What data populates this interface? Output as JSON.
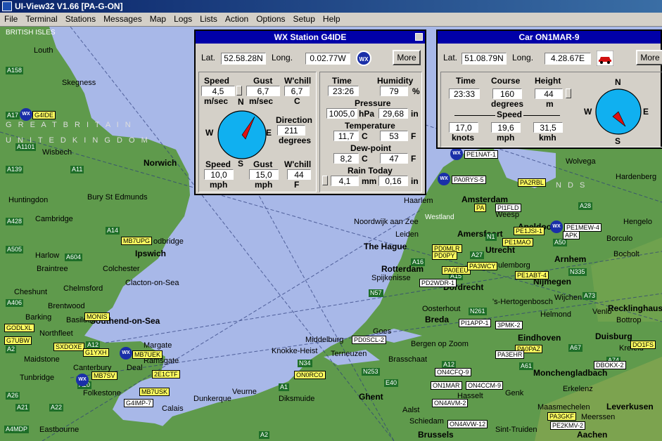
{
  "window": {
    "title": "UI-View32 V1.66 [PA-G-ON]"
  },
  "menu": [
    "File",
    "Terminal",
    "Stations",
    "Messages",
    "Map",
    "Logs",
    "Lists",
    "Action",
    "Options",
    "Setup",
    "Help"
  ],
  "map": {
    "regions": {
      "british_isles": "BRITISH ISLES",
      "great_britain": "G R E A T   B R I T A I N",
      "united_kingdom": "U N I T E D   K I N G D O M",
      "nl_frag": "N D S"
    },
    "places": {
      "louth": "Louth",
      "skegness": "Skegness",
      "wisbech": "Wisbech",
      "norwich": "Norwich",
      "huntingdon": "Huntingdon",
      "bury": "Bury St Edmunds",
      "cambridge": "Cambridge",
      "ipswich": "Ipswich",
      "woodbridge": "odbridge",
      "harlow": "Harlow",
      "braintree": "Braintree",
      "colchester": "Colchester",
      "chelmsford": "Chelmsford",
      "clacton": "Clacton-on-Sea",
      "cheshunt": "Cheshunt",
      "brentwood": "Brentwood",
      "basildon": "Basildon",
      "barking": "Barking",
      "southend": "Southend-on-Sea",
      "northfleet": "Northfleet",
      "maidstone": "Maidstone",
      "margate": "Margate",
      "ramsgate": "Ramsgate",
      "canterbury": "Canterbury",
      "deal": "Deal",
      "tunbridge": "Tunbridge",
      "folkestone": "Folkestone",
      "calais": "Calais",
      "dunkerque": "Dunkerque",
      "veurne": "Veurne",
      "diksmuide": "Diksmuide",
      "eastbourne": "Eastbourne",
      "knokke": "Knokke-Heist",
      "middelburg": "Middelburg",
      "terneuzen": "Terneuzen",
      "goes": "Goes",
      "brasschaat": "Brasschaat",
      "gent": "Ghent",
      "brussels": "Brussels",
      "aalst": "Aalst",
      "haarlem": "Haarlem",
      "amsterdam": "Amsterdam",
      "noordwijk": "Noordwijk aan Zee",
      "leiden": "Leiden",
      "hague": "The Hague",
      "rotterdam": "Rotterdam",
      "spijkenisse": "Spijkenisse",
      "dordrecht": "Dordrecht",
      "amersfoort": "Amersfoort",
      "apeldoorn": "Apeldoorn",
      "arnhem": "Arnhem",
      "utrecht": "Utrecht",
      "culemborg": "Culemborg",
      "nijmegen": "Nijmegen",
      "hertogenbosch": "'s-Hertogenbosch",
      "oosterhout": "Oosterhout",
      "breda": "Breda",
      "bergen_op_zoom": "Bergen op Zoom",
      "eindhoven": "Eindhoven",
      "helmond": "Helmond",
      "venlo": "Venlo",
      "moenchengladbach": "Monchengladbach",
      "erkelenz": "Erkelenz",
      "maasmechelen": "Maasmechelen",
      "sint_truiden": "Sint-Truiden",
      "aachen": "Aachen",
      "leverkusen": "Leverkusen",
      "duisburg": "Duisburg",
      "krefeld": "Krefeld",
      "bottrop": "Bottrop",
      "recklinghausen": "Recklinghausen",
      "hardenberg": "Hardenberg",
      "hengelo": "Hengelo",
      "wolvega": "Wolvega",
      "genk": "Genk",
      "hasselt": "Hasselt",
      "bocholt": "Bocholt",
      "wijchen": "Wijchen",
      "borculo": "Borculo",
      "weesp": "Weesp",
      "westland": "Westland",
      "meerssen": "Meerssen",
      "schiedam": "Schiedam"
    },
    "roads": [
      "A158",
      "A17",
      "A1101",
      "A139",
      "A11",
      "A14",
      "A428",
      "A505",
      "A604",
      "A406",
      "A2",
      "A12",
      "A26",
      "A21",
      "A22",
      "A20",
      "A4MDP",
      "N34",
      "N253",
      "N57",
      "N261",
      "A1",
      "E40",
      "A15",
      "A16",
      "A27",
      "A2",
      "A12",
      "N1",
      "A50",
      "A28",
      "N335",
      "A73",
      "A67",
      "A61",
      "A74"
    ],
    "stations": [
      "G4IDE",
      "MB7UPG",
      "MONIS",
      "GODLXL",
      "G7UBW",
      "SXDOXE",
      "G1YXH",
      "MB7UEK",
      "2E1CTF",
      "MB7SV",
      "G4IMP-7",
      "MB7USK",
      "PE1NAT-1",
      "PA0RYS-5",
      "PA2RBL",
      "PA",
      "PI1FLD",
      "PE1JSI-1",
      "PE1MEW-4",
      "APK",
      "PE1MAO",
      "PD0MLR",
      "PD0PY",
      "PA0EEU",
      "PA3WCY",
      "PE1ABT-4",
      "PD2WDR-1",
      "PI1APP-1",
      "3PMK-2",
      "PA0PAZ",
      "PA3EHR",
      "PD0SCL-2",
      "ON0RCO",
      "ON4CFQ-9",
      "ON1MAR",
      "ON4CCM-9",
      "ON4AVM-2",
      "ON4AVW-12",
      "PA3GKF",
      "PE2KMV-2",
      "DBOKX-2",
      "DO1FS"
    ]
  },
  "wx_panel": {
    "title": "WX Station  G4IDE",
    "lat_label": "Lat.",
    "lat": "52.58.28N",
    "long_label": "Long.",
    "long": "0.02.77W",
    "badge": "WX",
    "more": "More",
    "speed_label": "Speed",
    "gust_label": "Gust",
    "wchill_label": "W'chill",
    "speed_ms": "4,5",
    "gust_ms": "6,7",
    "wchill_c": "6,7",
    "unit_ms": "m/sec",
    "unit_c": "C",
    "direction_label": "Direction",
    "direction": "211",
    "degrees_label": "degrees",
    "compass_n": "N",
    "compass_e": "E",
    "compass_s": "S",
    "compass_w": "W",
    "speed_mph": "10,0",
    "gust_mph": "15,0",
    "wchill_f": "44",
    "unit_mph": "mph",
    "unit_f": "F",
    "time_label": "Time",
    "time": "23:26",
    "humidity_label": "Humidity",
    "humidity": "79",
    "unit_pct": "%",
    "pressure_label": "Pressure",
    "pressure_hpa": "1005,0",
    "unit_hpa": "hPa",
    "pressure_in": "29,68",
    "unit_in": "in",
    "temp_label": "Temperature",
    "temp_c": "11,7",
    "temp_f": "53",
    "dew_label": "Dew-point",
    "dew_c": "8,2",
    "dew_f": "47",
    "rain_label": "Rain Today",
    "rain_mm": "4,1",
    "unit_mm": "mm",
    "rain_in": "0,16"
  },
  "car_panel": {
    "title": "Car  ON1MAR-9",
    "lat_label": "Lat.",
    "lat": "51.08.79N",
    "long_label": "Long.",
    "long": "4.28.67E",
    "more": "More",
    "time_label": "Time",
    "time": "23:33",
    "course_label": "Course",
    "course": "160",
    "degrees_label": "degrees",
    "height_label": "Height",
    "height": "44",
    "unit_m": "m",
    "speed_label": "Speed",
    "speed_knots": "17,0",
    "speed_mph": "19,6",
    "speed_kmh": "31,5",
    "unit_knots": "knots",
    "unit_mph": "mph",
    "unit_kmh": "kmh",
    "compass_n": "N",
    "compass_e": "E",
    "compass_s": "S",
    "compass_w": "W"
  },
  "colors": {
    "titlebar": "#0a246a",
    "panel_title": "#0000a8",
    "sea": "#a8b8e8",
    "land": "#5f9a4c",
    "compass_fill": "#10b0f0",
    "needle": "#e01010"
  }
}
